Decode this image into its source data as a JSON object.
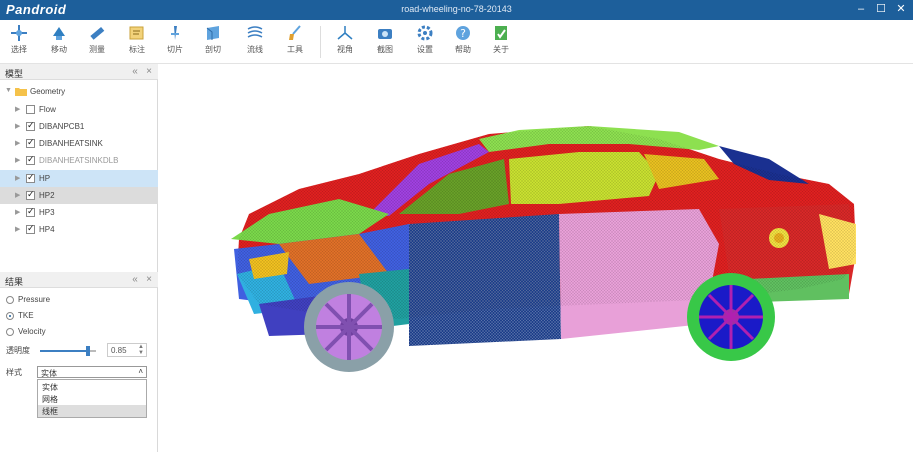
{
  "app": {
    "brand": "Pandroid",
    "window_title": "road-wheeling-no-78-20143"
  },
  "window_controls": {
    "minimize": "–",
    "maximize": "☐",
    "close": "✕"
  },
  "toolbar": {
    "buttons": [
      {
        "label": "选择",
        "icon": "pointer-icon"
      },
      {
        "label": "移动",
        "icon": "move-icon"
      },
      {
        "label": "测量",
        "icon": "ruler-icon"
      },
      {
        "label": "标注",
        "icon": "annotate-icon"
      },
      {
        "label": "切片",
        "icon": "slice-icon"
      },
      {
        "label": "剖切",
        "icon": "section-icon"
      },
      {
        "label": "流线",
        "icon": "streamline-icon"
      },
      {
        "label": "工具",
        "icon": "brush-icon"
      },
      {
        "label": "视角",
        "icon": "axes-icon"
      },
      {
        "label": "截图",
        "icon": "camera-icon"
      },
      {
        "label": "设置",
        "icon": "gear-icon"
      },
      {
        "label": "帮助",
        "icon": "help-icon"
      },
      {
        "label": "关于",
        "icon": "about-icon"
      }
    ]
  },
  "model_panel": {
    "title": "模型",
    "root": "Geometry",
    "items": [
      {
        "label": "Flow",
        "checked": false
      },
      {
        "label": "DIBANPCB1",
        "checked": true
      },
      {
        "label": "DIBANHEATSINK",
        "checked": true
      },
      {
        "label": "DIBANHEATSINKDLB",
        "checked": true
      },
      {
        "label": "HP",
        "checked": true
      },
      {
        "label": "HP2",
        "checked": true
      },
      {
        "label": "HP3",
        "checked": true
      },
      {
        "label": "HP4",
        "checked": true
      }
    ]
  },
  "result_panel": {
    "title": "结果",
    "fields": [
      {
        "label": "Pressure",
        "selected": false
      },
      {
        "label": "TKE",
        "selected": true
      },
      {
        "label": "Velocity",
        "selected": false
      }
    ],
    "opacity_label": "透明度",
    "opacity_value": "0.85",
    "opacity_fraction": 0.85,
    "style_label": "样式",
    "style_value": "实体",
    "style_options": [
      "实体",
      "网格",
      "线框"
    ]
  },
  "colors": {
    "titlebar": "#1d5f9b",
    "selection": "#cde4f7"
  }
}
